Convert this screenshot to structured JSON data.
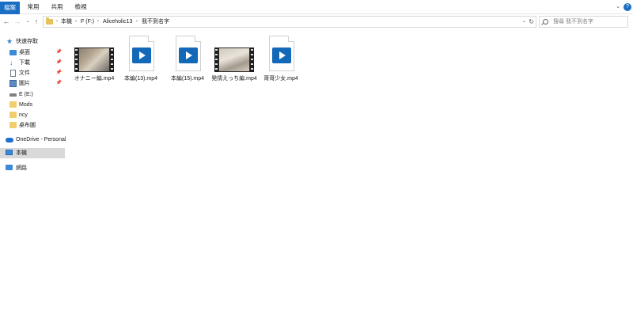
{
  "ribbon": {
    "tabs": [
      "檔案",
      "常用",
      "共用",
      "檢視"
    ]
  },
  "address": {
    "crumbs": [
      "本機",
      "F (F:)",
      "Aliceholic13",
      "我不到名字"
    ]
  },
  "search": {
    "placeholder": "搜尋 我不到名字"
  },
  "sidebar": {
    "items": [
      {
        "label": "快速存取",
        "icon": "star-icon"
      },
      {
        "label": "桌面",
        "icon": "desktop-icon",
        "pinned": true
      },
      {
        "label": "下載",
        "icon": "download-icon",
        "pinned": true
      },
      {
        "label": "文件",
        "icon": "document-icon",
        "pinned": true
      },
      {
        "label": "圖片",
        "icon": "pictures-icon",
        "pinned": true
      },
      {
        "label": "E (E:)",
        "icon": "drive-icon"
      },
      {
        "label": "Mods",
        "icon": "folder-icon"
      },
      {
        "label": "ncy",
        "icon": "folder-icon"
      },
      {
        "label": "桌布圖",
        "icon": "folder-icon"
      },
      {
        "label": "OneDrive - Personal",
        "icon": "onedrive-icon"
      },
      {
        "label": "本機",
        "icon": "this-pc-icon",
        "selected": true
      },
      {
        "label": "網路",
        "icon": "network-icon"
      }
    ]
  },
  "files": [
    {
      "name": "オナニー編.mp4",
      "thumb": "video-thumbnail"
    },
    {
      "name": "本編(13).mp4",
      "thumb": "video-file-icon"
    },
    {
      "name": "本編(15).mp4",
      "thumb": "video-file-icon"
    },
    {
      "name": "発情えっち編.mp4",
      "thumb": "video-thumbnail"
    },
    {
      "name": "哥哥少女.mp4",
      "thumb": "video-file-icon"
    }
  ],
  "colors": {
    "accent": "#1a6fc4",
    "selected_bg": "#d9d9d9",
    "folder": "#f2cd6b"
  }
}
